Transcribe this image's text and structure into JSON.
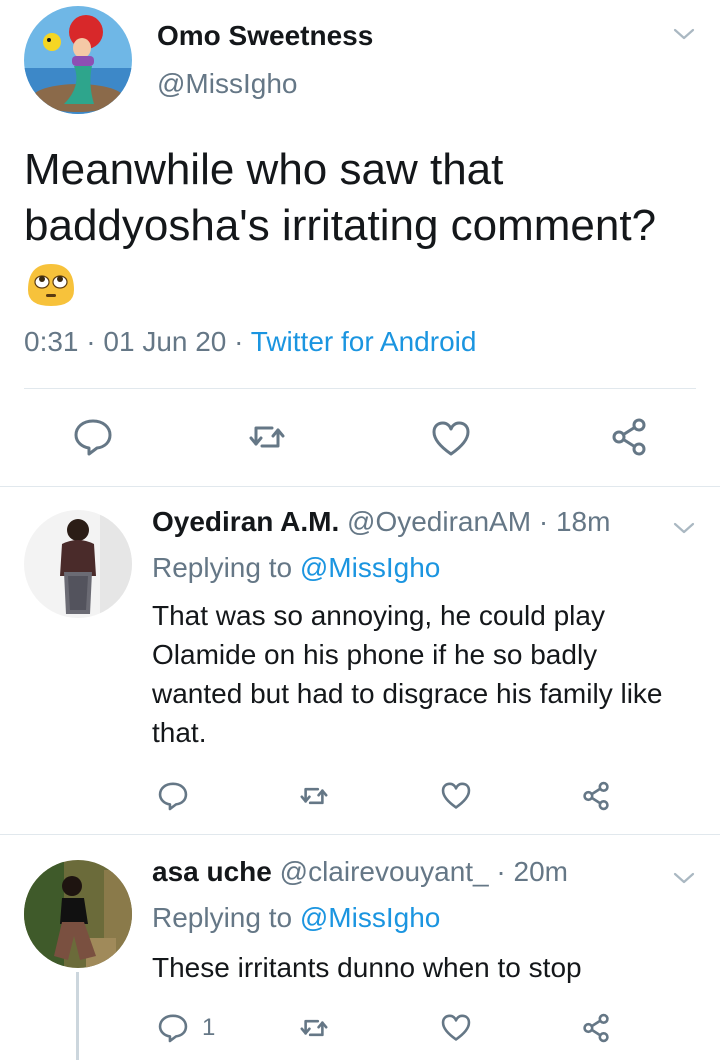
{
  "main_tweet": {
    "author_name": "Omo Sweetness",
    "author_handle": "@MissIgho",
    "text": "Meanwhile who saw that baddyosha's irritating comment?",
    "emoji": "face-with-rolling-eyes",
    "time": "0:31",
    "date": "01 Jun 20",
    "source": "Twitter for Android",
    "separator": " · "
  },
  "replies": [
    {
      "name": "Oyediran A.M.",
      "handle": "@OyediranAM",
      "age": "18m",
      "replying_prefix": "Replying to ",
      "replying_to": "@MissIgho",
      "text": "That was so annoying, he could play Olamide on his phone if he so  badly wanted but had to disgrace his family like that.",
      "reply_count": ""
    },
    {
      "name": "asa uche",
      "handle": "@clairevouyant_",
      "age": "20m",
      "replying_prefix": "Replying to ",
      "replying_to": "@MissIgho",
      "text": "These irritants dunno when to stop",
      "reply_count": "1"
    }
  ],
  "colors": {
    "text": "#14171a",
    "secondary": "#657786",
    "link": "#1b95e0",
    "divider": "#e1e8ed"
  }
}
